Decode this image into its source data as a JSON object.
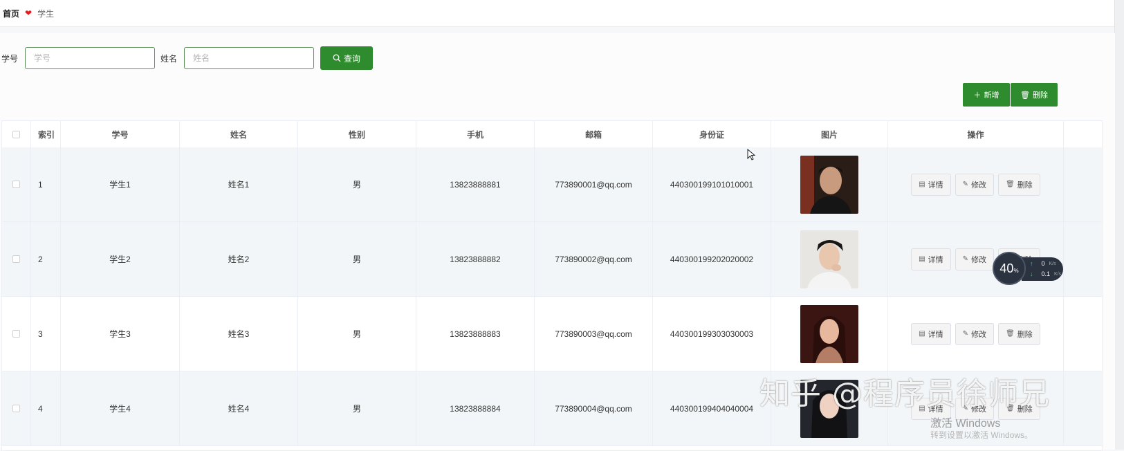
{
  "breadcrumb": {
    "home": "首页",
    "current": "学生"
  },
  "search": {
    "id_label": "学号",
    "id_placeholder": "学号",
    "name_label": "姓名",
    "name_placeholder": "姓名",
    "query_label": "查询"
  },
  "toolbar": {
    "add_label": "新增",
    "delete_label": "删除"
  },
  "table": {
    "headers": [
      "索引",
      "学号",
      "姓名",
      "性别",
      "手机",
      "邮箱",
      "身份证",
      "图片",
      "操作"
    ],
    "rows": [
      {
        "index": "1",
        "student_id": "学生1",
        "name": "姓名1",
        "gender": "男",
        "phone": "13823888881",
        "email": "773890001@qq.com",
        "id_card": "440300199101010001"
      },
      {
        "index": "2",
        "student_id": "学生2",
        "name": "姓名2",
        "gender": "男",
        "phone": "13823888882",
        "email": "773890002@qq.com",
        "id_card": "440300199202020002"
      },
      {
        "index": "3",
        "student_id": "学生3",
        "name": "姓名3",
        "gender": "男",
        "phone": "13823888883",
        "email": "773890003@qq.com",
        "id_card": "440300199303030003"
      },
      {
        "index": "4",
        "student_id": "学生4",
        "name": "姓名4",
        "gender": "男",
        "phone": "13823888884",
        "email": "773890004@qq.com",
        "id_card": "440300199404040004"
      }
    ],
    "actions": {
      "detail": "详情",
      "edit": "修改",
      "delete": "删除"
    }
  },
  "net_widget": {
    "percent": "40",
    "percent_unit": "%",
    "up": "0",
    "down": "0.1",
    "unit": "K/s"
  },
  "overlay": {
    "watermark": "知乎 @程序员徐师兄",
    "activate": "激活 Windows",
    "activate_sub": "转到设置以激活 Windows。"
  },
  "colors": {
    "primary": "#2e8b2e",
    "heart": "#e02020"
  }
}
